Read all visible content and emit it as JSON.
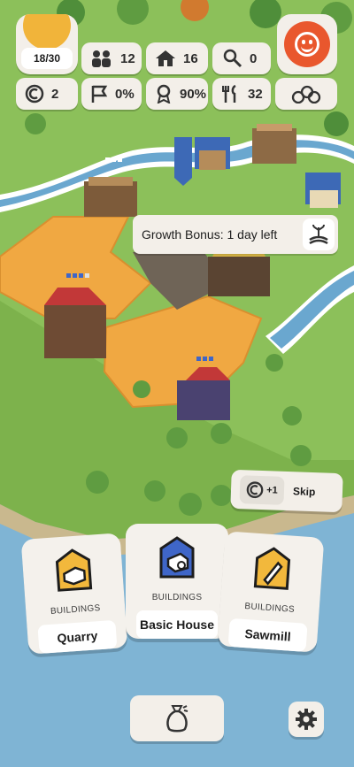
{
  "top_bar": {
    "day_counter": "18/30",
    "stats_row1": [
      {
        "icon": "population-icon",
        "value": "12"
      },
      {
        "icon": "house-icon",
        "value": "16"
      },
      {
        "icon": "food-icon",
        "value": "0"
      }
    ],
    "stats_row2": [
      {
        "icon": "coin-icon",
        "value": "2"
      },
      {
        "icon": "flag-icon",
        "value": "0%"
      },
      {
        "icon": "ribbon-icon",
        "value": "90%"
      },
      {
        "icon": "cutlery-icon",
        "value": "32"
      },
      {
        "icon": "logs-icon",
        "value": ""
      }
    ],
    "happiness_icon": "smiley-icon"
  },
  "tooltip": {
    "text": "Growth Bonus: 1 day left",
    "icon": "growth-icon"
  },
  "skip_button": {
    "coin_value": "+1",
    "label": "Skip"
  },
  "cards": [
    {
      "type_label": "BUILDINGS",
      "name": "Quarry",
      "icon": "quarry-icon"
    },
    {
      "type_label": "BUILDINGS",
      "name": "Basic House",
      "icon": "basic-house-icon"
    },
    {
      "type_label": "BUILDINGS",
      "name": "Sawmill",
      "icon": "sawmill-icon"
    }
  ],
  "bottom_bar": {
    "bag_icon": "sack-icon",
    "settings_icon": "gear-icon"
  },
  "colors": {
    "field": "#f0a842",
    "grass": "#8cc05a",
    "water": "#7fb4d4",
    "panel": "#f3efe9",
    "accent_orange": "#e9572d",
    "card_blue": "#3f66c8",
    "card_yellow": "#f2b83c"
  }
}
